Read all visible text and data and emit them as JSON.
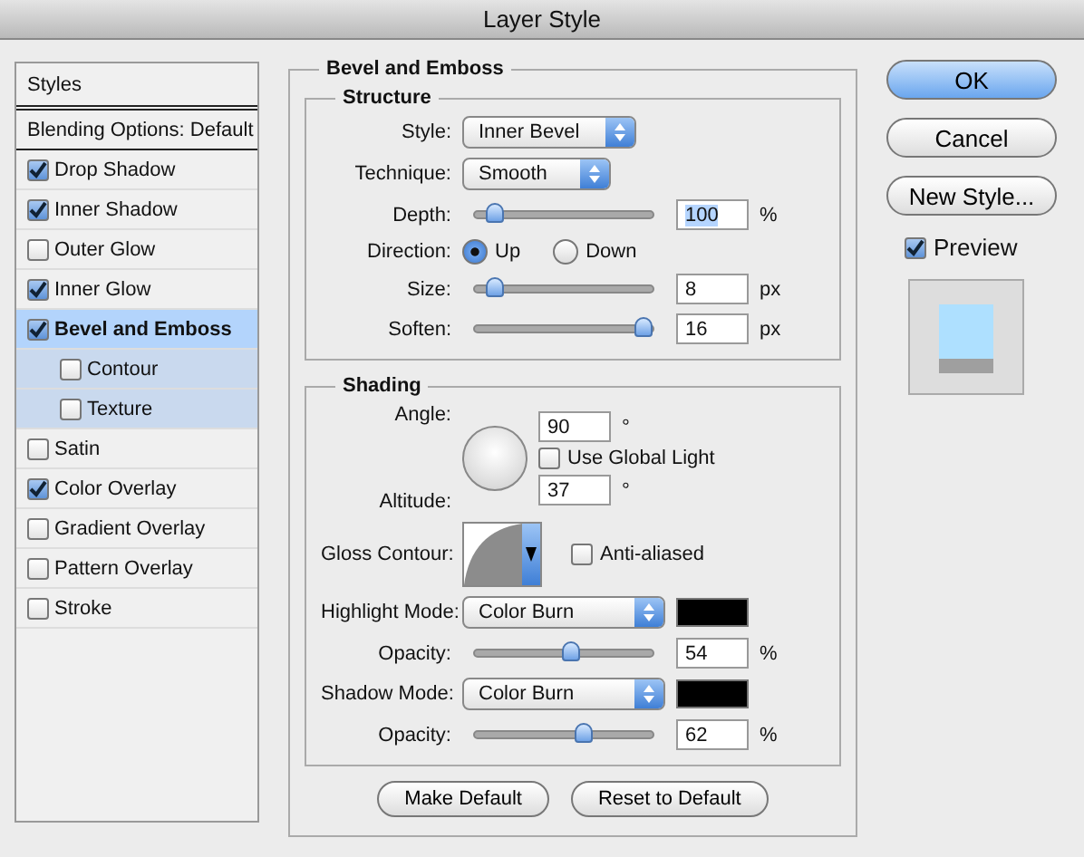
{
  "window": {
    "title": "Layer Style"
  },
  "styles_panel": {
    "header": "Styles",
    "items": [
      {
        "label": "Blending Options: Default",
        "kind": "plain",
        "selected": false
      },
      {
        "label": "Drop Shadow",
        "kind": "checkbox",
        "checked": true,
        "selected": false
      },
      {
        "label": "Inner Shadow",
        "kind": "checkbox",
        "checked": true,
        "selected": false
      },
      {
        "label": "Outer Glow",
        "kind": "checkbox",
        "checked": false,
        "selected": false
      },
      {
        "label": "Inner Glow",
        "kind": "checkbox",
        "checked": true,
        "selected": false
      },
      {
        "label": "Bevel and Emboss",
        "kind": "checkbox",
        "checked": true,
        "selected": true,
        "children": [
          {
            "label": "Contour",
            "kind": "checkbox",
            "checked": false,
            "selected": false
          },
          {
            "label": "Texture",
            "kind": "checkbox",
            "checked": false,
            "selected": false
          }
        ]
      },
      {
        "label": "Satin",
        "kind": "checkbox",
        "checked": false,
        "selected": false
      },
      {
        "label": "Color Overlay",
        "kind": "checkbox",
        "checked": true,
        "selected": false
      },
      {
        "label": "Gradient Overlay",
        "kind": "checkbox",
        "checked": false,
        "selected": false
      },
      {
        "label": "Pattern Overlay",
        "kind": "checkbox",
        "checked": false,
        "selected": false
      },
      {
        "label": "Stroke",
        "kind": "checkbox",
        "checked": false,
        "selected": false
      }
    ]
  },
  "bevel_and_emboss": {
    "title": "Bevel and Emboss",
    "structure": {
      "title": "Structure",
      "style": {
        "label": "Style:",
        "value": "Inner Bevel"
      },
      "technique": {
        "label": "Technique:",
        "value": "Smooth"
      },
      "depth": {
        "label": "Depth:",
        "level": 0.07,
        "value": "100",
        "unit": "%",
        "value_selected": true
      },
      "direction": {
        "label": "Direction:",
        "options": [
          {
            "label": "Up",
            "selected": true
          },
          {
            "label": "Down",
            "selected": false
          }
        ]
      },
      "size": {
        "label": "Size:",
        "level": 0.07,
        "value": "8",
        "unit": "px",
        "value_selected": false
      },
      "soften": {
        "label": "Soften:",
        "level": 1,
        "value": "16",
        "unit": "px",
        "value_selected": false
      }
    },
    "shading": {
      "title": "Shading",
      "angle": {
        "label": "Angle:",
        "value": "90",
        "unit": "°"
      },
      "use_global_light": {
        "label": "Use Global Light",
        "checked": false
      },
      "altitude": {
        "label": "Altitude:",
        "value": "37",
        "unit": "°"
      },
      "gloss_contour": {
        "label": "Gloss Contour:"
      },
      "anti_aliased": {
        "label": "Anti-aliased",
        "checked": false
      },
      "highlight_mode": {
        "label": "Highlight Mode:",
        "value": "Color Burn",
        "color": "#000000"
      },
      "highlight_opacity": {
        "label": "Opacity:",
        "level": 0.54,
        "value": "54",
        "unit": "%",
        "value_selected": false
      },
      "shadow_mode": {
        "label": "Shadow Mode:",
        "value": "Color Burn",
        "color": "#000000"
      },
      "shadow_opacity": {
        "label": "Opacity:",
        "level": 0.62,
        "value": "62",
        "unit": "%",
        "value_selected": false
      }
    },
    "buttons": [
      "Make Default",
      "Reset to Default"
    ]
  },
  "actions": {
    "buttons": [
      {
        "label": "OK",
        "default": true
      },
      {
        "label": "Cancel",
        "default": false
      },
      {
        "label": "New Style...",
        "default": false
      }
    ],
    "preview": {
      "label": "Preview",
      "checked": true
    }
  }
}
